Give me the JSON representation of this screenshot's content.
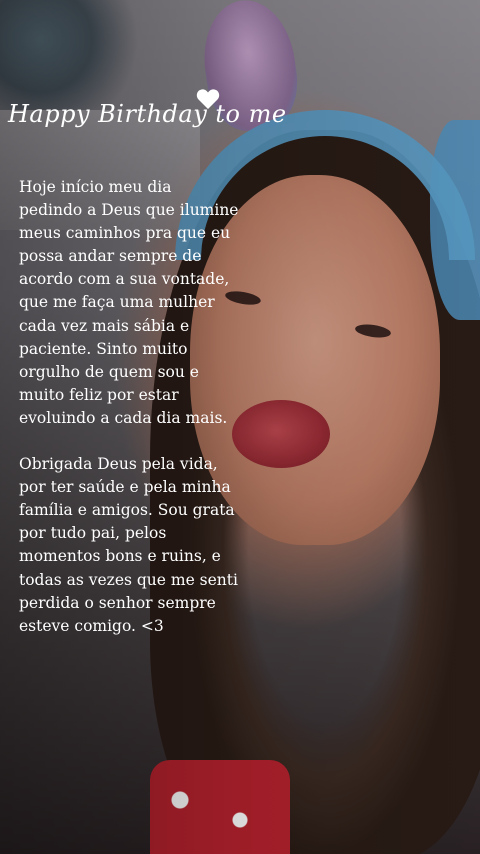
{
  "title": "Happy Birthday to me",
  "heart_icon": "heart-icon",
  "message": {
    "paragraph_1": "Hoje início meu dia pedindo a Deus que ilumine meus caminhos pra que eu possa andar sempre de acordo com a sua vontade, que me faça uma mulher cada vez mais sábia e paciente. Sinto muito orgulho de quem sou e muito feliz por estar evoluindo a cada dia mais.",
    "paragraph_2": "Obrigada Deus pela vida, por ter saúde e pela minha família e amigos. Sou grata por tudo pai, pelos momentos bons e ruins, e todas as vezes que me senti perdida o senhor sempre esteve comigo. <3"
  },
  "colors": {
    "text": "#ffffff",
    "headband": "#5a9ec9",
    "lips": "#9c2c36"
  }
}
